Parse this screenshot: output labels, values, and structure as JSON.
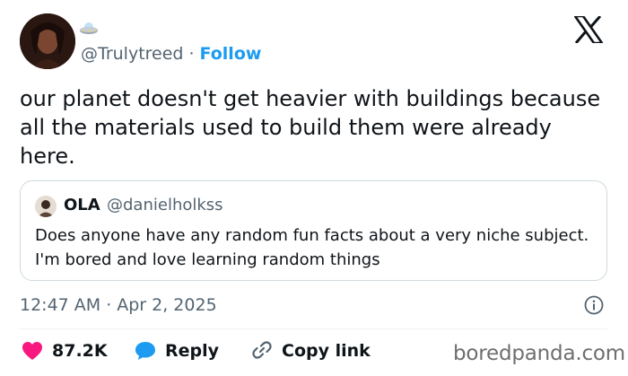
{
  "author": {
    "handle": "@Trulytreed",
    "separator": "·",
    "follow_label": "Follow"
  },
  "tweet": {
    "text": "our planet doesn't get heavier with buildings because all the materials used to build them were already here."
  },
  "quote": {
    "name": "OLA",
    "handle": "@danielholkss",
    "text": "Does anyone have any random fun facts about a very niche subject. I'm bored and love learning random things"
  },
  "meta": {
    "time": "12:47 AM",
    "separator": "·",
    "date": "Apr 2, 2025"
  },
  "actions": {
    "likes": "87.2K",
    "reply_label": "Reply",
    "copy_label": "Copy link"
  },
  "watermark": "boredpanda.com",
  "colors": {
    "accent": "#1d9bf0",
    "like": "#f91880",
    "text": "#0f1419",
    "muted": "#536471"
  },
  "icons": [
    "ufo-icon",
    "x-logo-icon",
    "info-icon",
    "heart-icon",
    "reply-bubble-icon",
    "link-icon"
  ]
}
